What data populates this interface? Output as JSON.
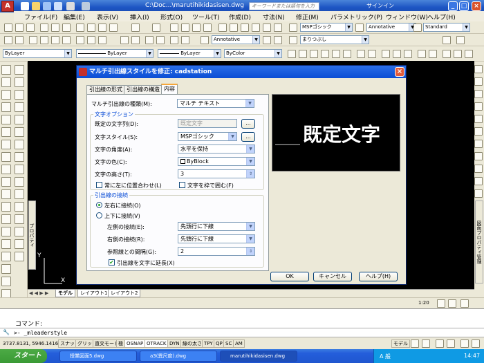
{
  "window": {
    "title": "C:\\Doc...\\marutihikidasisen.dwg",
    "search_placeholder": "キーワードまたは語句を入力",
    "signin": "サインイン"
  },
  "menu": [
    "ファイル(F)",
    "編集(E)",
    "表示(V)",
    "挿入(I)",
    "形式(O)",
    "ツール(T)",
    "作成(D)",
    "寸法(N)",
    "修正(M)",
    "パラメトリック(P)",
    "ウィンドウ(W)",
    "ヘルプ(H)"
  ],
  "toolbar": {
    "textstyle": "MSPゴシック",
    "annoscale": "Annotative",
    "dimstyle": "Standard",
    "annoscale2": "Annotative",
    "mleaderstyle": "まりつぶし",
    "layer": "ByLayer",
    "linetype": "ByLayer",
    "lineweight": "ByLayer",
    "plotstyle": "ByColor"
  },
  "dialog": {
    "title": "マルチ引出線スタイルを修正: cadstation",
    "tabs": [
      "引出線の形式",
      "引出線の構造",
      "内容"
    ],
    "content_type_label": "マルチ引出線の種類(M):",
    "content_type": "マルチ テキスト",
    "text_options_title": "文字オプション",
    "default_text_label": "既定の文字列(D):",
    "default_text": "既定文字",
    "text_style_label": "文字スタイル(S):",
    "text_style": "MSPゴシック",
    "text_angle_label": "文字の角度(A):",
    "text_angle": "水平を保持",
    "text_color_label": "文字の色(C):",
    "text_color": "ByBlock",
    "text_height_label": "文字の高さ(T):",
    "text_height": "3",
    "always_left_label": "常に左に位置合わせ(L)",
    "frame_text_label": "文字を枠で囲む(F)",
    "leader_conn_title": "引出線の接続",
    "horiz_label": "左右に接続(O)",
    "vert_label": "上下に接続(V)",
    "left_conn_label": "左側の接続(E):",
    "left_conn": "先頭行に下線",
    "right_conn_label": "右側の接続(R):",
    "right_conn": "先頭行に下線",
    "landing_gap_label": "参照線との間隔(G):",
    "landing_gap": "2",
    "extend_label": "引出線を文字に延長(X)",
    "preview_text": "既定文字",
    "ok": "OK",
    "cancel": "キャンセル",
    "help": "ヘルプ(H)",
    "browse": "..."
  },
  "layout_tabs": [
    "モデル",
    "レイアウト1",
    "レイアウト2"
  ],
  "annoscale_status": "1:20",
  "command": {
    "prompt": "コマンド:",
    "input": "_mleaderstyle"
  },
  "status": {
    "coords": "3737.8131, 5946.1416",
    "buttons": [
      "スナップ",
      "グリッド",
      "直交モード",
      "極",
      "OSNAP",
      "OTRACK",
      "DYN",
      "線の太さ",
      "TPY",
      "QP",
      "SC",
      "AM"
    ],
    "model": "モデル"
  },
  "taskbar": {
    "start": "スタート",
    "tasks": [
      "授業図面5.dwg",
      "a3(異尺度).dwg",
      "marutihikidasisen.dwg"
    ],
    "clock": "14:47",
    "ime": "A 般"
  },
  "side_tabs": {
    "left": "プロパティ",
    "right": "図面プロパティ管理"
  }
}
